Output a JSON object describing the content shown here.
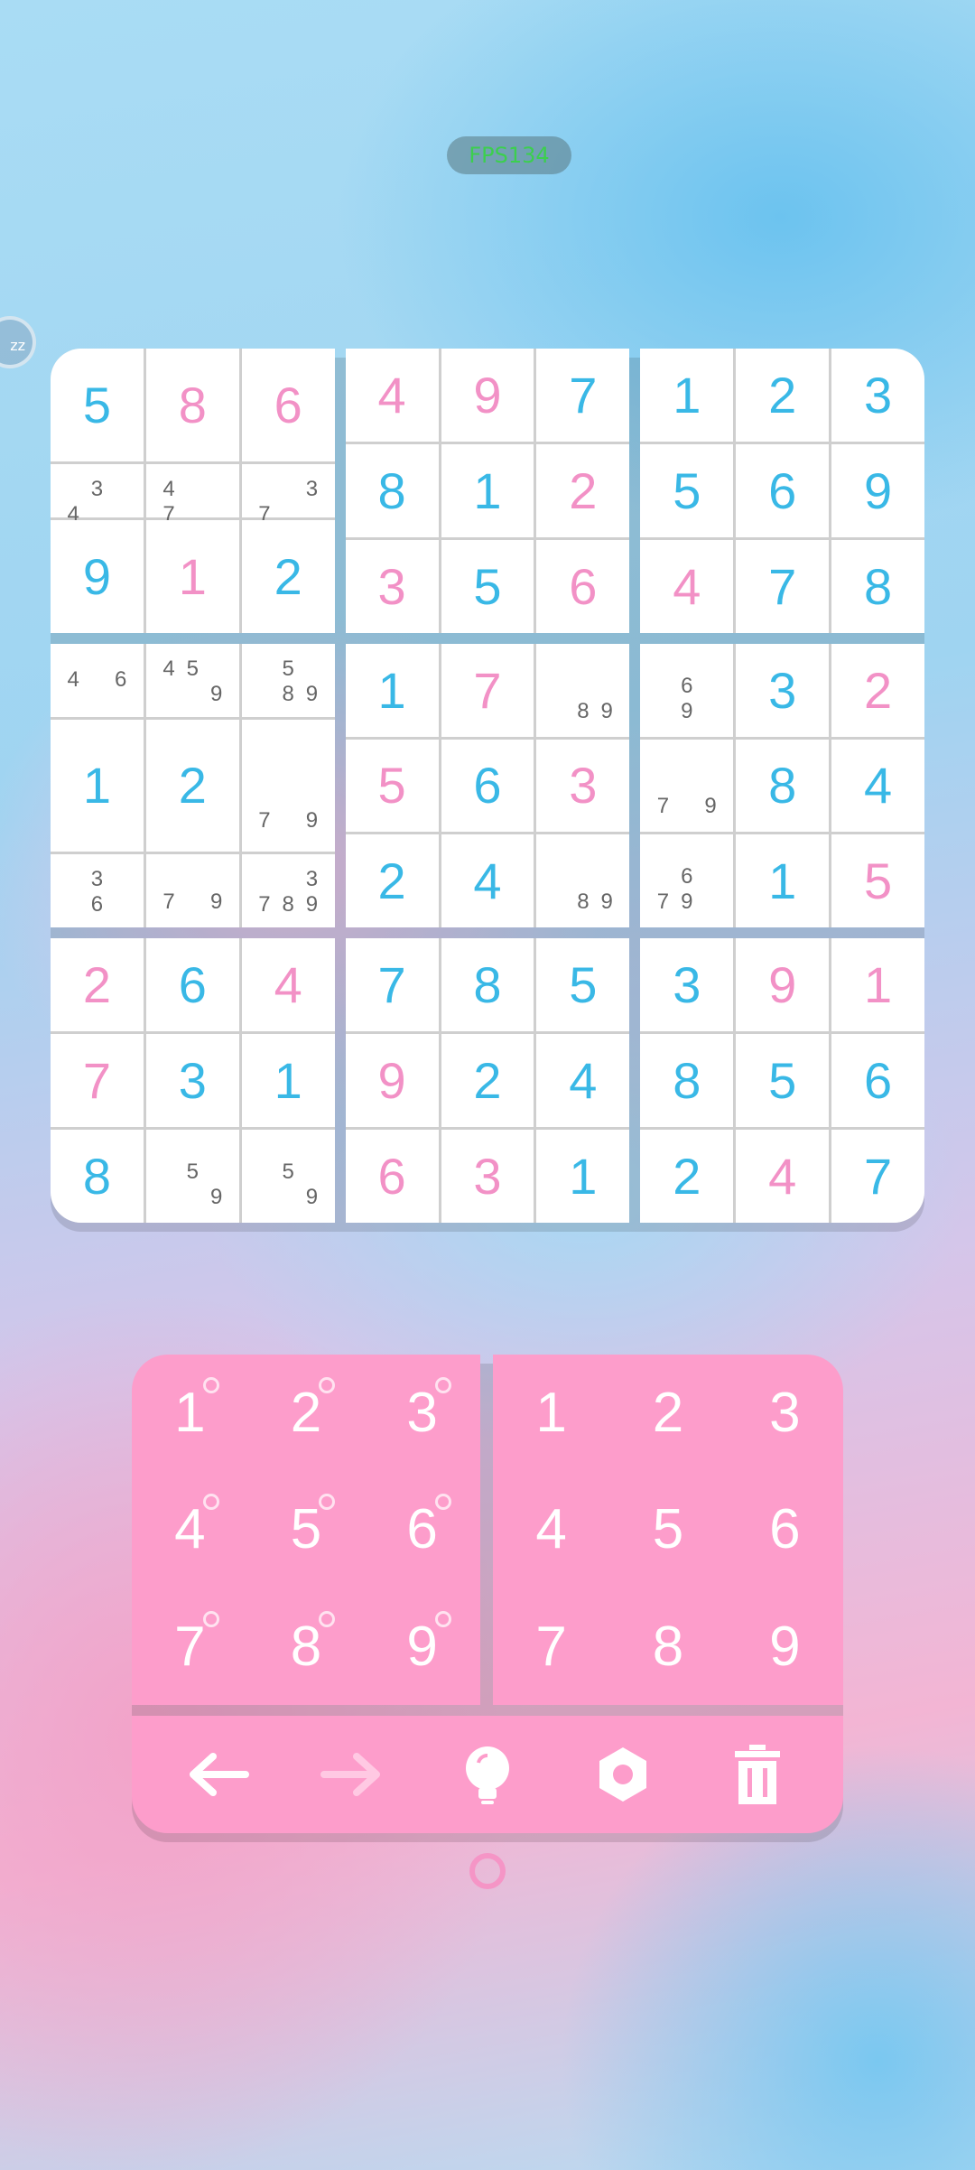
{
  "status": {
    "fps": "FPS134",
    "side_badge": "zz"
  },
  "colors": {
    "given": "#39b8e6",
    "user": "#f291c6",
    "pad": "#fd9dcb",
    "note": "#666666"
  },
  "board": [
    [
      {
        "v": "5",
        "t": "g"
      },
      {
        "v": "8",
        "t": "u"
      },
      {
        "v": "6",
        "t": "u"
      },
      {
        "v": "4",
        "t": "u"
      },
      {
        "v": "9",
        "t": "u"
      },
      {
        "v": "7",
        "t": "g"
      },
      {
        "v": "1",
        "t": "g"
      },
      {
        "v": "2",
        "t": "g"
      },
      {
        "v": "3",
        "t": "g"
      }
    ],
    [
      {
        "n": [
          "",
          "3",
          "",
          "4",
          "",
          "",
          "",
          "",
          ""
        ]
      },
      {
        "n": [
          "",
          "",
          "",
          "4",
          "",
          "",
          "7",
          "",
          ""
        ]
      },
      {
        "n": [
          "",
          "",
          "3",
          "",
          "",
          "",
          "7",
          "",
          ""
        ]
      },
      {
        "v": "8",
        "t": "g"
      },
      {
        "v": "1",
        "t": "g"
      },
      {
        "v": "2",
        "t": "u"
      },
      {
        "v": "5",
        "t": "g"
      },
      {
        "v": "6",
        "t": "g"
      },
      {
        "v": "9",
        "t": "g"
      }
    ],
    [
      {
        "v": "9",
        "t": "g"
      },
      {
        "v": "1",
        "t": "u"
      },
      {
        "v": "2",
        "t": "g"
      },
      {
        "v": "3",
        "t": "u"
      },
      {
        "v": "5",
        "t": "g"
      },
      {
        "v": "6",
        "t": "u"
      },
      {
        "v": "4",
        "t": "u"
      },
      {
        "v": "7",
        "t": "g"
      },
      {
        "v": "8",
        "t": "g"
      }
    ],
    [
      {
        "n": [
          "",
          "",
          "",
          "4",
          "",
          "6",
          "",
          "",
          ""
        ]
      },
      {
        "n": [
          "",
          "",
          "",
          "4",
          "5",
          "",
          "",
          "",
          "9"
        ]
      },
      {
        "n": [
          "",
          "",
          "",
          "",
          "5",
          "",
          "",
          "8",
          "9"
        ]
      },
      {
        "v": "1",
        "t": "g"
      },
      {
        "v": "7",
        "t": "u"
      },
      {
        "n": [
          "",
          "",
          "",
          "",
          "",
          "",
          "",
          "8",
          "9"
        ]
      },
      {
        "n": [
          "",
          "",
          "",
          "",
          "6",
          "",
          "",
          "9",
          ""
        ]
      },
      {
        "v": "3",
        "t": "g"
      },
      {
        "v": "2",
        "t": "u"
      }
    ],
    [
      {
        "v": "1",
        "t": "g"
      },
      {
        "v": "2",
        "t": "g"
      },
      {
        "n": [
          "",
          "",
          "",
          "",
          "",
          "",
          "7",
          "",
          "9"
        ]
      },
      {
        "v": "5",
        "t": "u"
      },
      {
        "v": "6",
        "t": "g"
      },
      {
        "v": "3",
        "t": "u"
      },
      {
        "n": [
          "",
          "",
          "",
          "",
          "",
          "",
          "7",
          "",
          "9"
        ]
      },
      {
        "v": "8",
        "t": "g"
      },
      {
        "v": "4",
        "t": "g"
      }
    ],
    [
      {
        "n": [
          "",
          "3",
          "",
          "",
          "6",
          "",
          "",
          "",
          ""
        ]
      },
      {
        "n": [
          "",
          "",
          "",
          "",
          "",
          "",
          "7",
          "",
          "9"
        ]
      },
      {
        "n": [
          "",
          "",
          "3",
          "",
          "",
          "",
          "7",
          "8",
          "9"
        ]
      },
      {
        "v": "2",
        "t": "g"
      },
      {
        "v": "4",
        "t": "g"
      },
      {
        "n": [
          "",
          "",
          "",
          "",
          "",
          "",
          "",
          "8",
          "9"
        ]
      },
      {
        "n": [
          "",
          "",
          "",
          "",
          "6",
          "",
          "7",
          "9",
          ""
        ]
      },
      {
        "v": "1",
        "t": "g"
      },
      {
        "v": "5",
        "t": "u"
      }
    ],
    [
      {
        "v": "2",
        "t": "u"
      },
      {
        "v": "6",
        "t": "g"
      },
      {
        "v": "4",
        "t": "u"
      },
      {
        "v": "7",
        "t": "g"
      },
      {
        "v": "8",
        "t": "g"
      },
      {
        "v": "5",
        "t": "g"
      },
      {
        "v": "3",
        "t": "g"
      },
      {
        "v": "9",
        "t": "u"
      },
      {
        "v": "1",
        "t": "u"
      }
    ],
    [
      {
        "v": "7",
        "t": "u"
      },
      {
        "v": "3",
        "t": "g"
      },
      {
        "v": "1",
        "t": "g"
      },
      {
        "v": "9",
        "t": "u"
      },
      {
        "v": "2",
        "t": "g"
      },
      {
        "v": "4",
        "t": "g"
      },
      {
        "v": "8",
        "t": "g"
      },
      {
        "v": "5",
        "t": "g"
      },
      {
        "v": "6",
        "t": "g"
      }
    ],
    [
      {
        "v": "8",
        "t": "g"
      },
      {
        "n": [
          "",
          "",
          "",
          "",
          "5",
          "",
          "",
          "",
          "9"
        ]
      },
      {
        "n": [
          "",
          "",
          "",
          "",
          "5",
          "",
          "",
          "",
          "9"
        ]
      },
      {
        "v": "6",
        "t": "u"
      },
      {
        "v": "3",
        "t": "u"
      },
      {
        "v": "1",
        "t": "g"
      },
      {
        "v": "2",
        "t": "g"
      },
      {
        "v": "4",
        "t": "u"
      },
      {
        "v": "7",
        "t": "g"
      }
    ]
  ],
  "pad": {
    "note_keys": [
      "1",
      "2",
      "3",
      "4",
      "5",
      "6",
      "7",
      "8",
      "9"
    ],
    "value_keys": [
      "1",
      "2",
      "3",
      "4",
      "5",
      "6",
      "7",
      "8",
      "9"
    ],
    "tools": [
      "undo-icon",
      "redo-icon",
      "hint-icon",
      "settings-icon",
      "erase-icon"
    ]
  }
}
